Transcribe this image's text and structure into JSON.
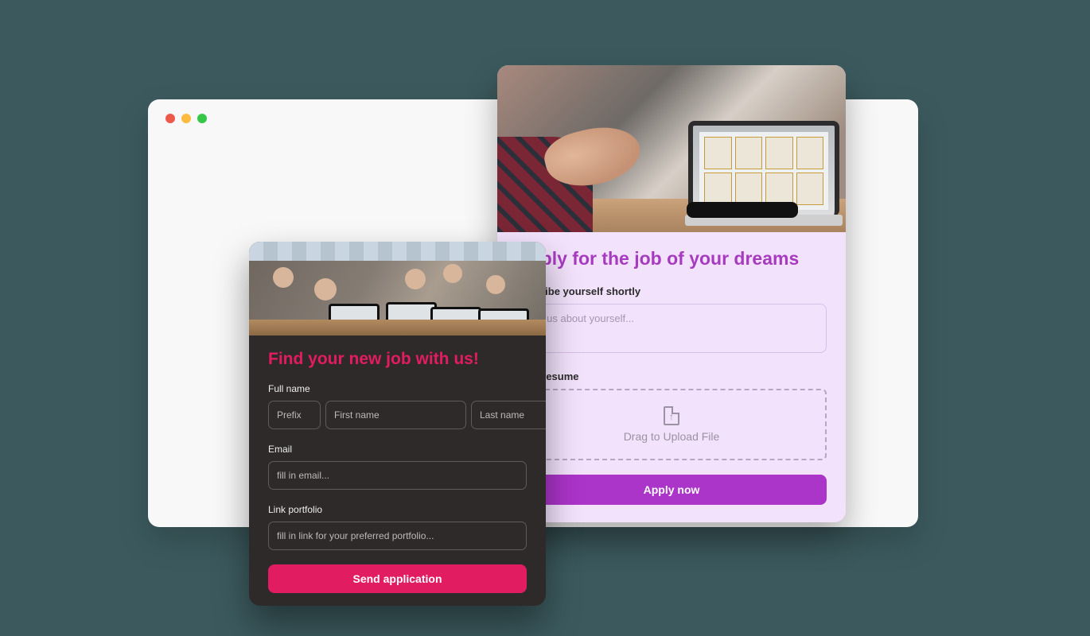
{
  "purple_card": {
    "title": "Apply for the job of your dreams",
    "describe": {
      "label": "Describe yourself shortly",
      "placeholder": "Tell us about yourself..."
    },
    "resume": {
      "label": "Your resume",
      "dropzone_text": "Drag to Upload File"
    },
    "submit_label": "Apply now"
  },
  "dark_card": {
    "title": "Find your new job with us!",
    "fullname": {
      "label": "Full name",
      "prefix_placeholder": "Prefix",
      "first_placeholder": "First name",
      "last_placeholder": "Last name"
    },
    "email": {
      "label": "Email",
      "placeholder": "fill in email..."
    },
    "portfolio": {
      "label": "Link portfolio",
      "placeholder": "fill in link for your preferred portfolio..."
    },
    "submit_label": "Send application"
  }
}
